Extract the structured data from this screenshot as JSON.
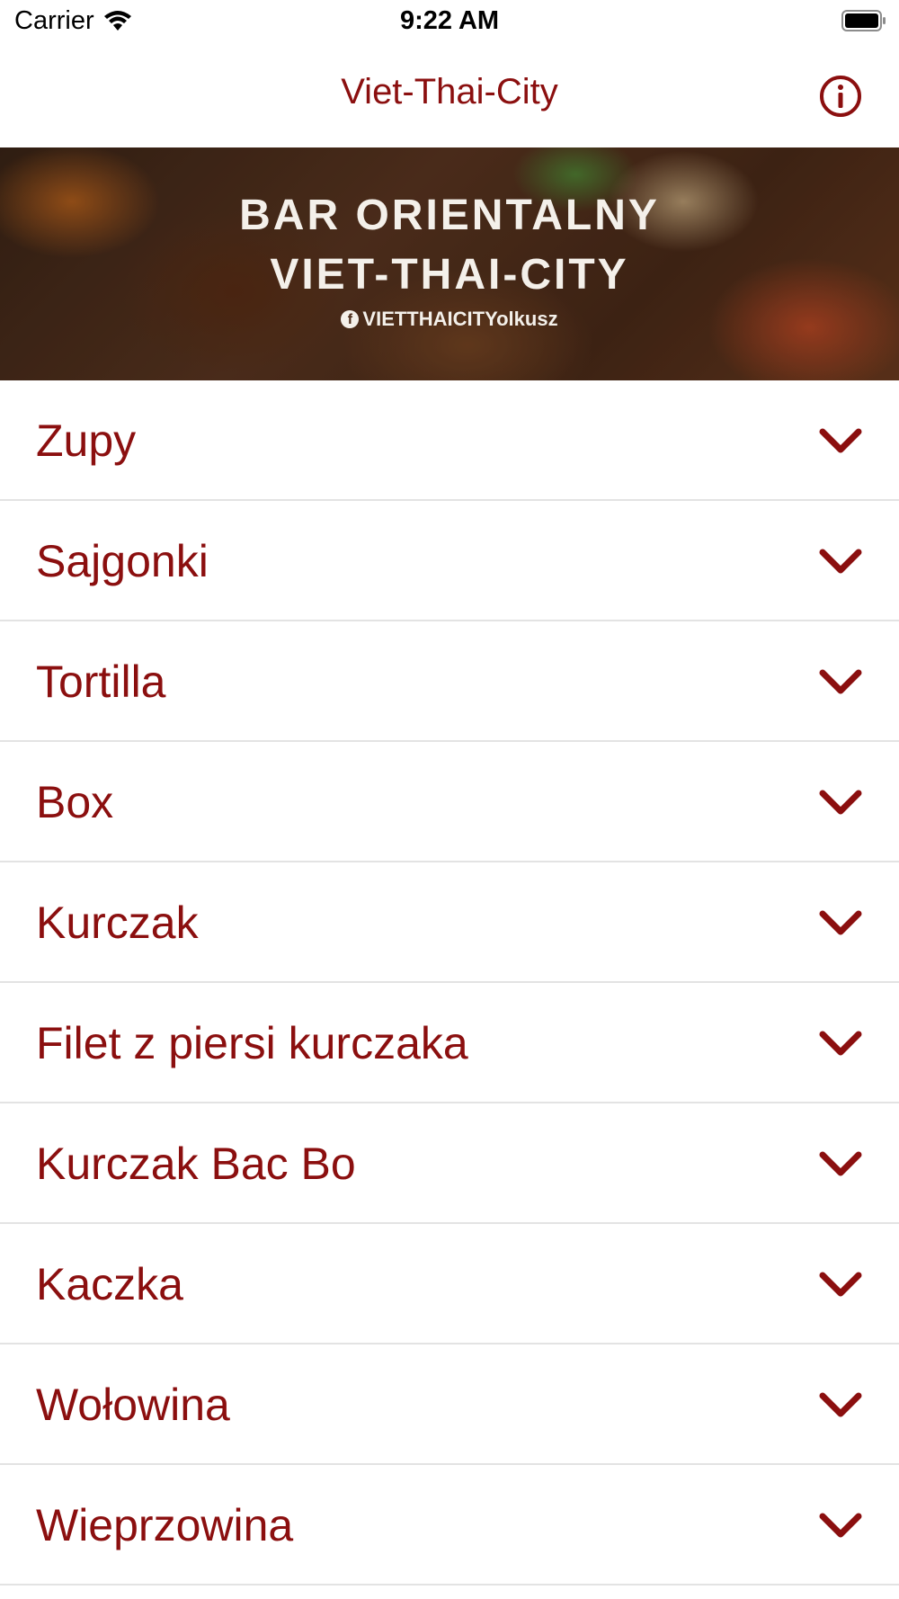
{
  "status_bar": {
    "carrier": "Carrier",
    "time": "9:22 AM"
  },
  "nav": {
    "title": "Viet-Thai-City"
  },
  "banner": {
    "line1": "BAR ORIENTALNY",
    "line2": "VIET-THAI-CITY",
    "handle": "VIETTHAICITYolkusz"
  },
  "menu": {
    "items": [
      {
        "label": "Zupy"
      },
      {
        "label": "Sajgonki"
      },
      {
        "label": "Tortilla"
      },
      {
        "label": "Box"
      },
      {
        "label": "Kurczak"
      },
      {
        "label": "Filet z piersi kurczaka"
      },
      {
        "label": "Kurczak Bac Bo"
      },
      {
        "label": "Kaczka"
      },
      {
        "label": "Wołowina"
      },
      {
        "label": "Wieprzowina"
      }
    ]
  },
  "colors": {
    "accent": "#8b0f0f",
    "separator": "#e3e3e3"
  },
  "icons": {
    "status": [
      "wifi-icon",
      "battery-icon"
    ],
    "nav": "info-icon",
    "row": "chevron-down-icon"
  }
}
